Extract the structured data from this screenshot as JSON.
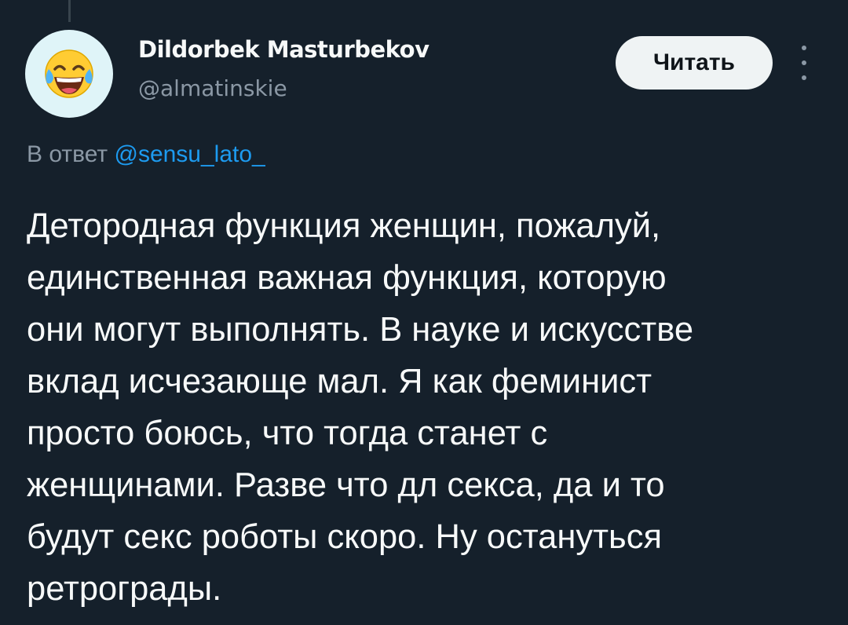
{
  "tweet": {
    "author": {
      "display_name": "Dildorbek Masturbekov",
      "handle": "@almatinskie",
      "avatar_icon": "tears-of-joy-emoji-icon"
    },
    "follow_label": "Читать",
    "more_icon": "more-vertical-icon",
    "reply_prefix": "В ответ",
    "reply_mention": "@sensu_lato_",
    "text_lines": [
      "Детородная функция женщин, пожалуй,",
      "единственная важная функция, которую",
      "они могут выполнять. В науке и искусстве",
      "вклад исчезающе мал. Я как феминист",
      "просто боюсь, что тогда станет с",
      "женщинами. Разве что дл секса, да и то",
      "будут секс роботы скоро. Ну остануться",
      "ретрограды."
    ]
  },
  "colors": {
    "background": "#15202b",
    "primary_text": "#f7f9f9",
    "secondary_text": "#8b98a5",
    "link": "#1d9bf0",
    "button_bg": "#eff3f4"
  }
}
